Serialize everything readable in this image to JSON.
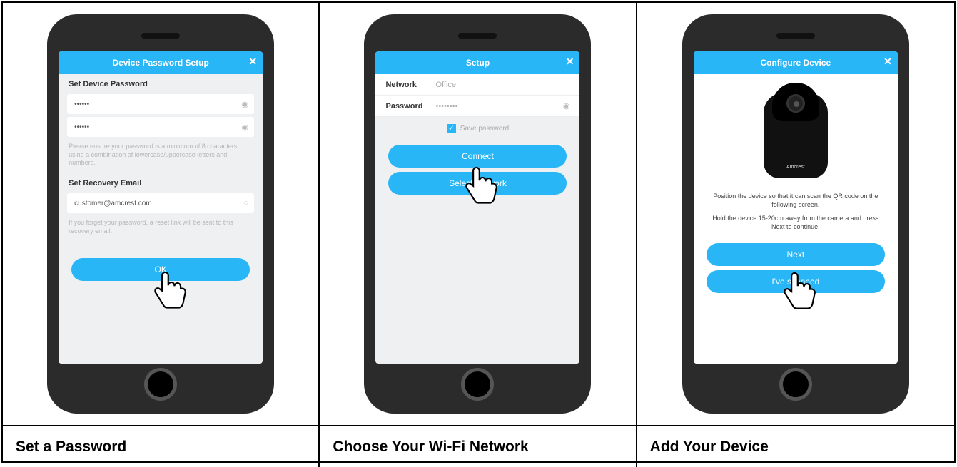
{
  "captions": [
    "Set a Password",
    "Choose Your Wi-Fi Network",
    "Add Your Device"
  ],
  "phone1": {
    "title": "Device Password Setup",
    "section1": "Set Device Password",
    "pw1": "••••••",
    "pw2": "••••••",
    "help1": "Please ensure your password is a minimum of 8 characters, using a combination of lowercase/uppercase letters and numbers.",
    "section2": "Set Recovery Email",
    "email": "customer@amcrest.com",
    "help2": "If you forget your password, a reset link will be sent to this recovery email.",
    "button": "OK"
  },
  "phone2": {
    "title": "Setup",
    "network_label": "Network",
    "network_value": "Office",
    "password_label": "Password",
    "password_value": "••••••••",
    "save_pw": "Save password",
    "btn1": "Connect",
    "btn2": "Select Network"
  },
  "phone3": {
    "title": "Configure Device",
    "text1": "Position the device so that it can scan the QR code on the following screen.",
    "text2": "Hold the device 15-20cm away from the camera and press Next to continue.",
    "btn1": "Next",
    "btn2": "I've scanned"
  }
}
